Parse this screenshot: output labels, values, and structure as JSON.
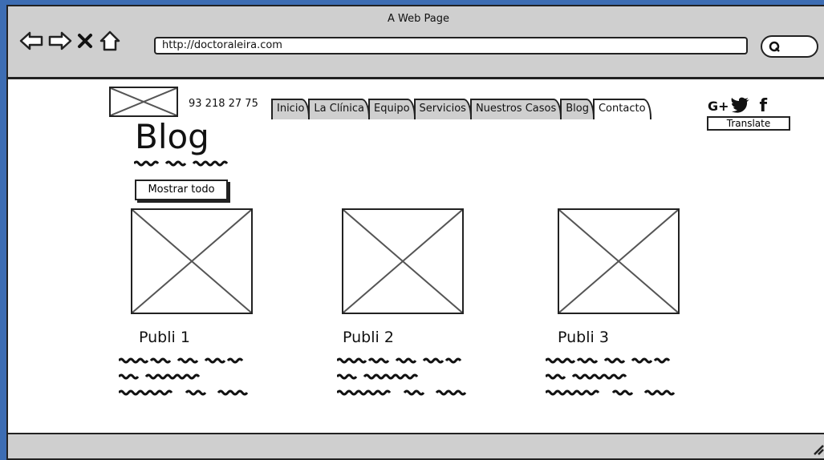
{
  "window": {
    "title": "A Web Page",
    "url": "http://doctoraleira.com"
  },
  "header": {
    "phone": "93 218 27 75",
    "tabs": [
      {
        "label": "Inicio"
      },
      {
        "label": "La Clínica"
      },
      {
        "label": "Equipo"
      },
      {
        "label": "Servicios"
      },
      {
        "label": "Nuestros Casos"
      },
      {
        "label": "Blog"
      },
      {
        "label": "Contacto"
      }
    ],
    "social": {
      "gplus": "G+",
      "facebook": "f"
    },
    "translate_label": "Translate"
  },
  "main": {
    "title": "Blog",
    "show_all_label": "Mostrar todo",
    "posts": [
      {
        "title": "Publi 1"
      },
      {
        "title": "Publi 2"
      },
      {
        "title": "Publi 3"
      }
    ]
  }
}
